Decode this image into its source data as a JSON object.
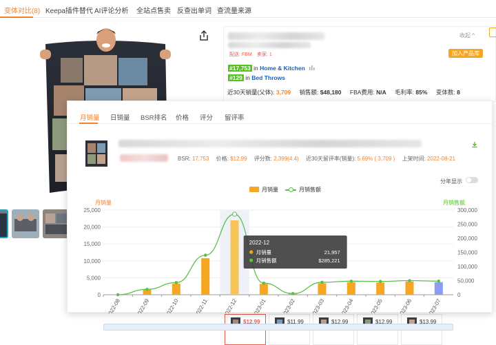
{
  "nav": {
    "tabs": [
      "变体对比(8)",
      "Keepa插件替代",
      "AI评论分析",
      "全站点售卖",
      "反查出单词",
      "查流量来源"
    ]
  },
  "product": {
    "badges": [
      "配送: FBM",
      "卖家: 1"
    ],
    "collapse_label": "收起 ^",
    "add_button": "加入产品库",
    "rank1": {
      "num": "#17,753",
      "in": "in",
      "cat": "Home & Kitchen"
    },
    "rank2": {
      "num": "#129",
      "in": "in",
      "cat": "Bed Throws"
    },
    "stats": [
      {
        "label": "近30天销量(父体):",
        "value": "3,709",
        "highlight": true
      },
      {
        "label": "销售额:",
        "value": "$48,180",
        "highlight": false
      },
      {
        "label": "FBA费用:",
        "value": "N/A",
        "highlight": false
      },
      {
        "label": "毛利率:",
        "value": "85%",
        "highlight": false
      },
      {
        "label": "变体数:",
        "value": "8",
        "highlight": false
      }
    ]
  },
  "panel": {
    "tabs": [
      "月销量",
      "日销量",
      "BSR排名",
      "价格",
      "评分",
      "留评率"
    ],
    "info": [
      {
        "label": "BSR:",
        "value": "17,753"
      },
      {
        "label": "价格:",
        "value": "$12.99"
      },
      {
        "label": "评分数:",
        "value": "2,399(4.4)"
      },
      {
        "label": "近30天留评率(销量):",
        "value": "5.69% ( 3,709 )"
      },
      {
        "label": "上架时间:",
        "value": "2022-08-21"
      }
    ],
    "year_switch": "分年显示",
    "legend": {
      "bar": "月销量",
      "line": "月销售额"
    }
  },
  "chart_data": {
    "type": "bar",
    "categories": [
      "2022-08",
      "2022-09",
      "2022-10",
      "2022-11",
      "2022-12",
      "2023-01",
      "2023-02",
      "2023-03",
      "2023-04",
      "2023-05",
      "2023-06",
      "2023-07"
    ],
    "series": [
      {
        "name": "月销量",
        "type": "bar",
        "axis": "left",
        "values": [
          0,
          1500,
          3300,
          10800,
          21957,
          3200,
          300,
          3400,
          3700,
          3600,
          3900,
          3709
        ]
      },
      {
        "name": "月销售额",
        "type": "line",
        "axis": "right",
        "values": [
          0,
          19000,
          43000,
          140000,
          285221,
          41000,
          4000,
          44000,
          48000,
          47000,
          50000,
          48180
        ]
      }
    ],
    "ylabel": "月销量",
    "y2label": "月销售额",
    "ylim": [
      0,
      25000
    ],
    "y2lim": [
      0,
      300000
    ],
    "yticks": [
      "0",
      "5,000",
      "10,000",
      "15,000",
      "20,000",
      "25,000"
    ],
    "y2ticks": [
      "0",
      "50,000",
      "100,000",
      "150,000",
      "200,000",
      "250,000",
      "300,000"
    ],
    "highlight_index": 4,
    "tooltip": {
      "title": "2022-12",
      "rows": [
        {
          "label": "月销量",
          "value": "21,957",
          "color": "#f5a623"
        },
        {
          "label": "月销售额",
          "value": "$285,221",
          "color": "#5bbf4a"
        }
      ]
    },
    "colors": {
      "bar": "#f5a623",
      "bar_highlight": "#f7c458",
      "bar_last": "#8c9cf0",
      "line": "#5bbf4a",
      "axis_label": "#f5822a",
      "axis_label_right": "#52c41a"
    }
  },
  "variants": [
    {
      "price": "$12.99",
      "selected": true
    },
    {
      "price": "$11.99",
      "selected": false
    },
    {
      "price": "$12.99",
      "selected": false
    },
    {
      "price": "$12.99",
      "selected": false
    },
    {
      "price": "$13.99",
      "selected": false
    }
  ]
}
